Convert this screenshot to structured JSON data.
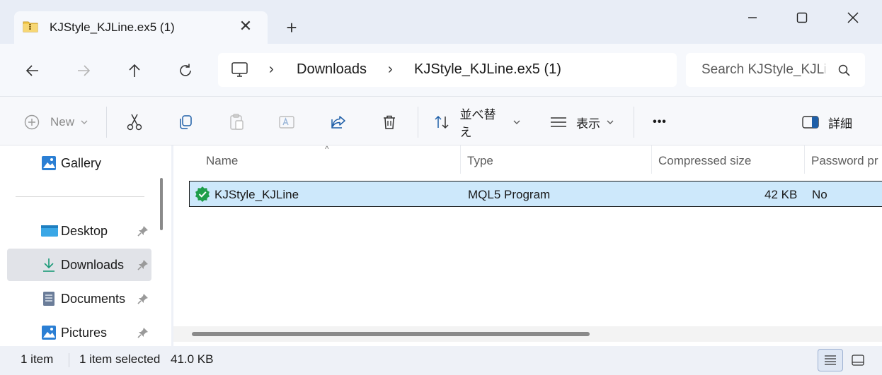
{
  "window": {
    "tab_title": "KJStyle_KJLine.ex5 (1)",
    "tab_close": "✕",
    "new_tab": "+"
  },
  "nav": {
    "breadcrumb": [
      "Downloads",
      "KJStyle_KJLine.ex5 (1)"
    ],
    "separator": "›",
    "search_placeholder": "Search KJStyle_KJLine.ex5 (1)"
  },
  "toolbar": {
    "new_label": "New",
    "sort_label": "並べ替え",
    "view_label": "表示",
    "more_label": "•••",
    "details_label": "詳細"
  },
  "sidebar": {
    "items": [
      {
        "label": "Gallery",
        "icon": "gallery-icon",
        "pinned": false
      },
      {
        "label": "Desktop",
        "icon": "desktop-icon",
        "pinned": true
      },
      {
        "label": "Downloads",
        "icon": "downloads-icon",
        "pinned": true
      },
      {
        "label": "Documents",
        "icon": "documents-icon",
        "pinned": true
      },
      {
        "label": "Pictures",
        "icon": "pictures-icon",
        "pinned": true
      }
    ]
  },
  "table": {
    "headers": [
      "Name",
      "Type",
      "Compressed size",
      "Password pr"
    ],
    "rows": [
      {
        "name": "KJStyle_KJLine",
        "type": "MQL5 Program",
        "compressed_size": "42 KB",
        "password": "No"
      }
    ]
  },
  "status": {
    "item_count": "1 item",
    "selected": "1 item selected",
    "size": "41.0 KB"
  },
  "colors": {
    "accent": "#0067c0",
    "selection": "#cde8fb",
    "mql_icon": "#1e9e4a"
  }
}
